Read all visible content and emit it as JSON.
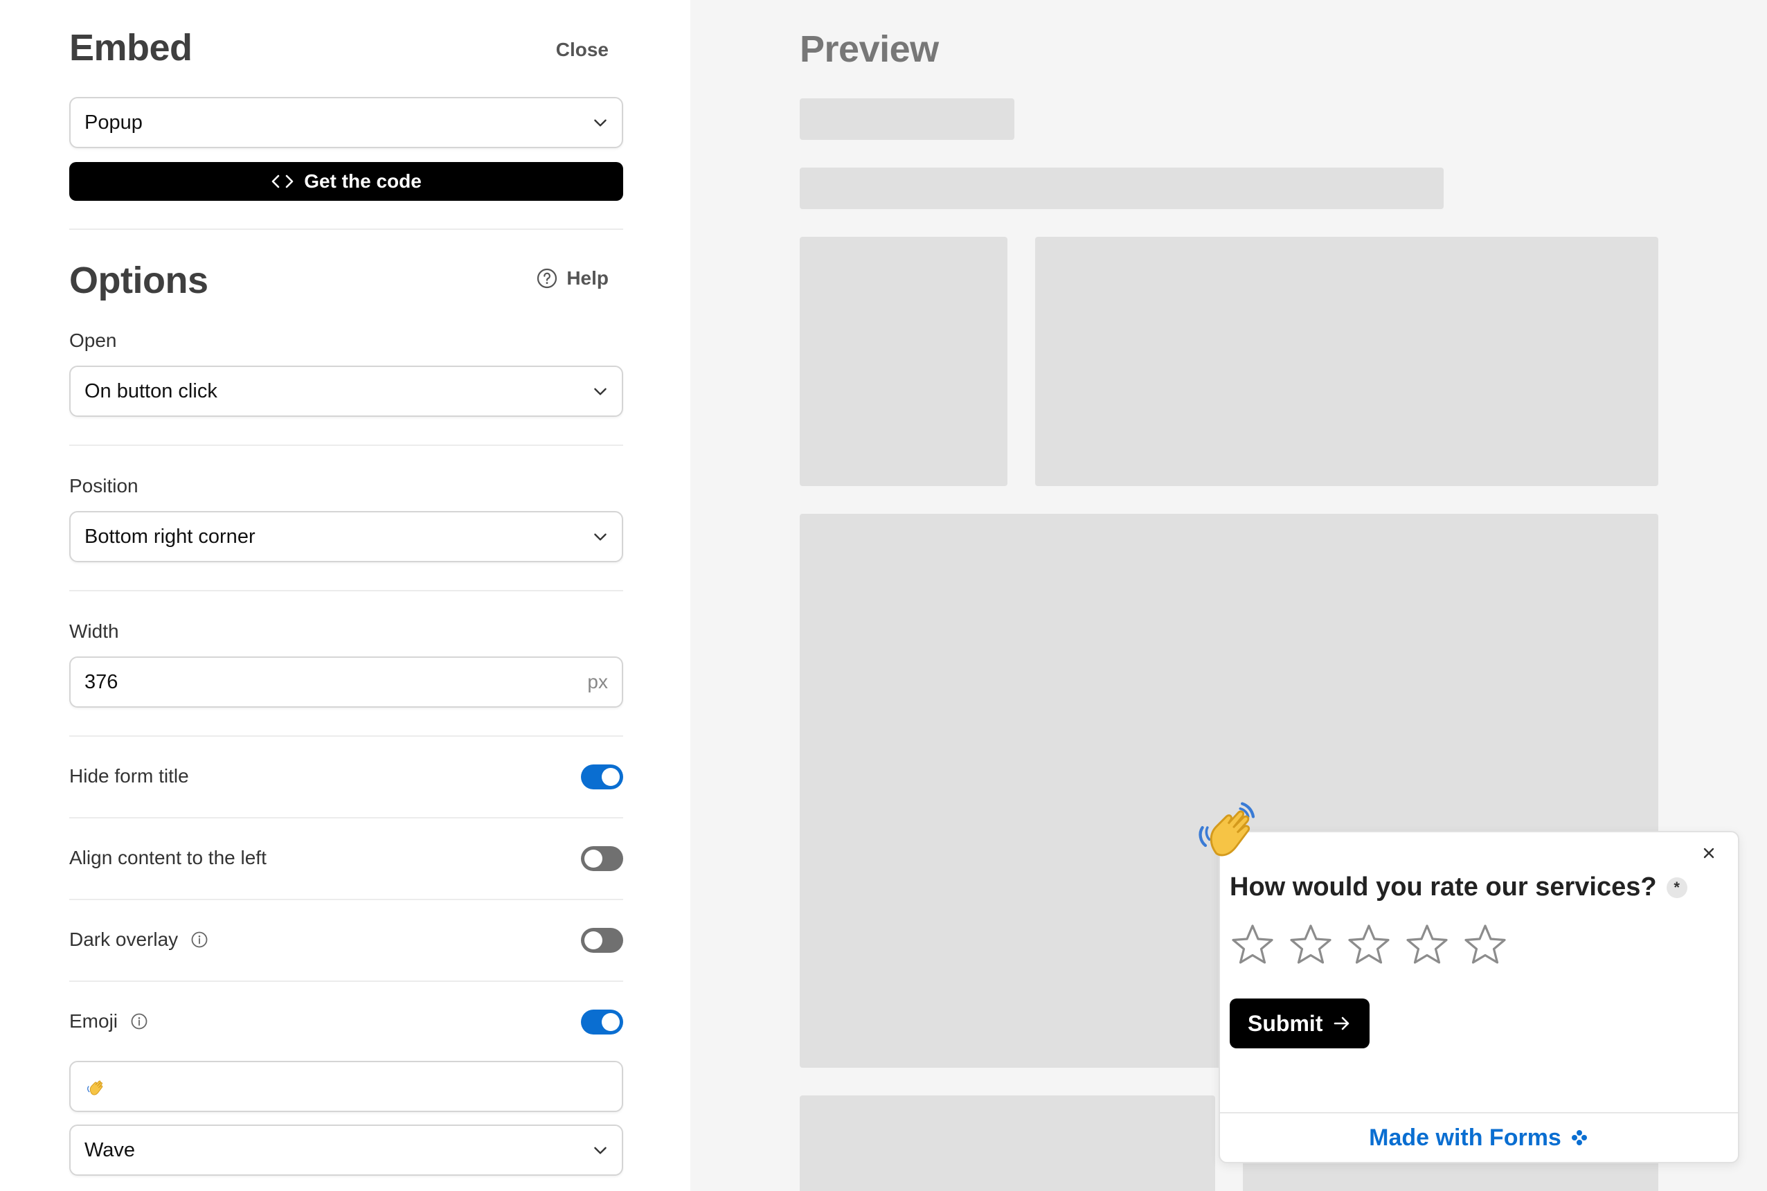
{
  "embed": {
    "title": "Embed",
    "close_label": "Close",
    "mode_select": {
      "value": "Popup"
    },
    "get_code_label": "Get the code"
  },
  "options": {
    "title": "Options",
    "help_label": "Help",
    "open": {
      "label": "Open",
      "value": "On button click"
    },
    "position": {
      "label": "Position",
      "value": "Bottom right corner"
    },
    "width": {
      "label": "Width",
      "value": "376",
      "unit": "px"
    },
    "toggles": {
      "hide_form_title": {
        "label": "Hide form title",
        "on": true
      },
      "align_left": {
        "label": "Align content to the left",
        "on": false
      },
      "dark_overlay": {
        "label": "Dark overlay",
        "on": false
      },
      "emoji": {
        "label": "Emoji",
        "on": true
      }
    },
    "emoji_value": "👋",
    "animation": {
      "value": "Wave"
    }
  },
  "preview": {
    "title": "Preview",
    "popup": {
      "question": "How would you rate our services?",
      "required_mark": "*",
      "rating": {
        "max_stars": 5,
        "selected": 0
      },
      "submit_label": "Submit",
      "footer_label": "Made with Forms"
    }
  },
  "colors": {
    "accent": "#0a6ed1",
    "toggle_off": "#707070",
    "skeleton": "#e0e0e0",
    "preview_bg": "#f5f5f5"
  }
}
